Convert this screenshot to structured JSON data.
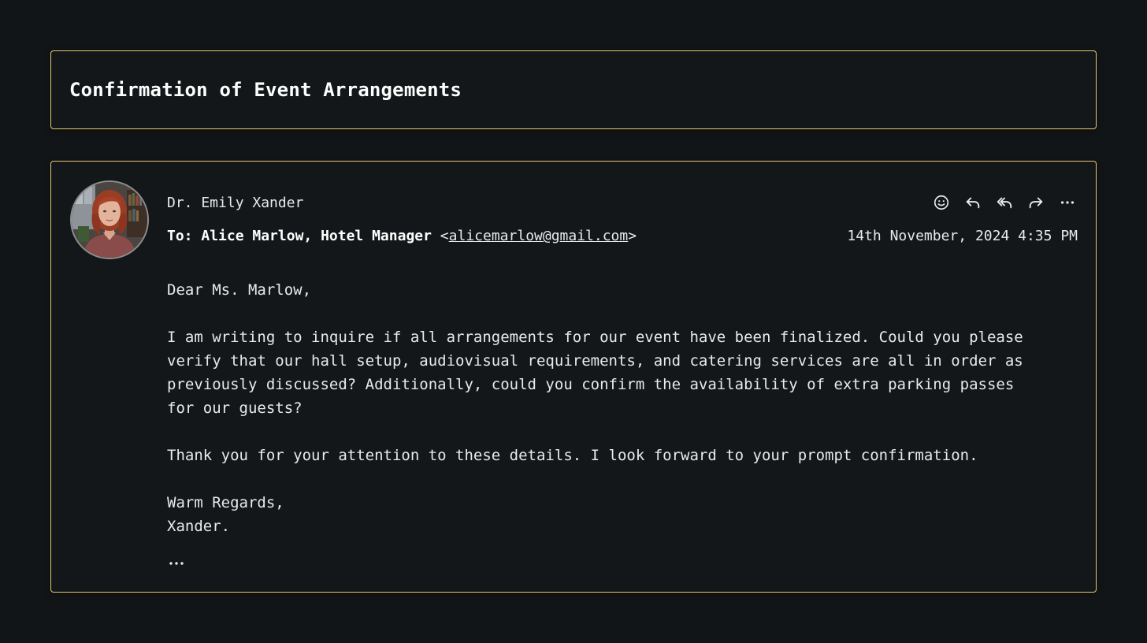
{
  "subject": "Confirmation of Event Arrangements",
  "sender": {
    "name": "Dr. Emily Xander"
  },
  "recipient": {
    "prefix": "To: ",
    "name": "Alice Marlow, Hotel Manager",
    "open": " <",
    "email": "alicemarlow@gmail.com",
    "close": ">"
  },
  "date": "14th November, 2024 4:35 PM",
  "actions": [
    "emoji-react",
    "reply",
    "reply-all",
    "forward",
    "more-options"
  ],
  "body": {
    "greeting": "Dear Ms. Marlow,",
    "paragraph1": "I am writing to inquire if all arrangements for our event have been finalized. Could you please verify that our hall setup, audiovisual requirements, and catering services are all in order as previously discussed? Additionally, could you confirm the availability of extra parking passes for our guests?",
    "paragraph2": "Thank you for your attention to these details. I look forward to your prompt confirmation.",
    "signoff": "Warm Regards,\nXander."
  },
  "colors": {
    "background": "#121517",
    "border_accent": "#e6c86e",
    "text": "#e9eaea"
  }
}
